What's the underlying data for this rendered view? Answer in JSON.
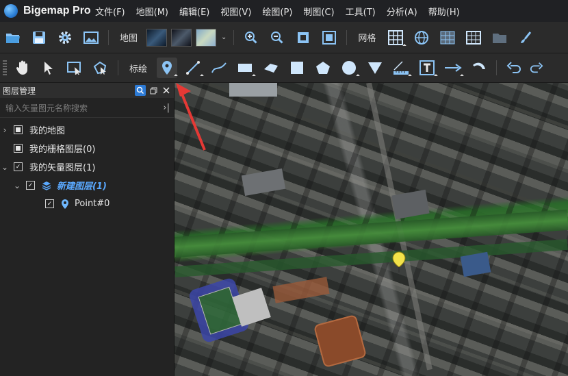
{
  "app": {
    "title": "Bigemap Pro"
  },
  "menu": [
    "文件(F)",
    "地图(M)",
    "编辑(E)",
    "视图(V)",
    "绘图(P)",
    "制图(C)",
    "工具(T)",
    "分析(A)",
    "帮助(H)"
  ],
  "toolbar1": {
    "map_label": "地图",
    "grid_label": "网格"
  },
  "toolbar2": {
    "annotate_label": "标绘"
  },
  "layer_panel": {
    "title": "图层管理",
    "search_placeholder": "输入矢量图元名称搜索",
    "tree": {
      "my_map": "我的地图",
      "raster_layers": "我的栅格图层(0)",
      "vector_layers": "我的矢量图层(1)",
      "new_layer": "新建图层(1)",
      "point": "Point#0"
    }
  },
  "colors": {
    "accent": "#5aa9ff",
    "marker": "#f2e24a",
    "arrow": "#e53935"
  }
}
